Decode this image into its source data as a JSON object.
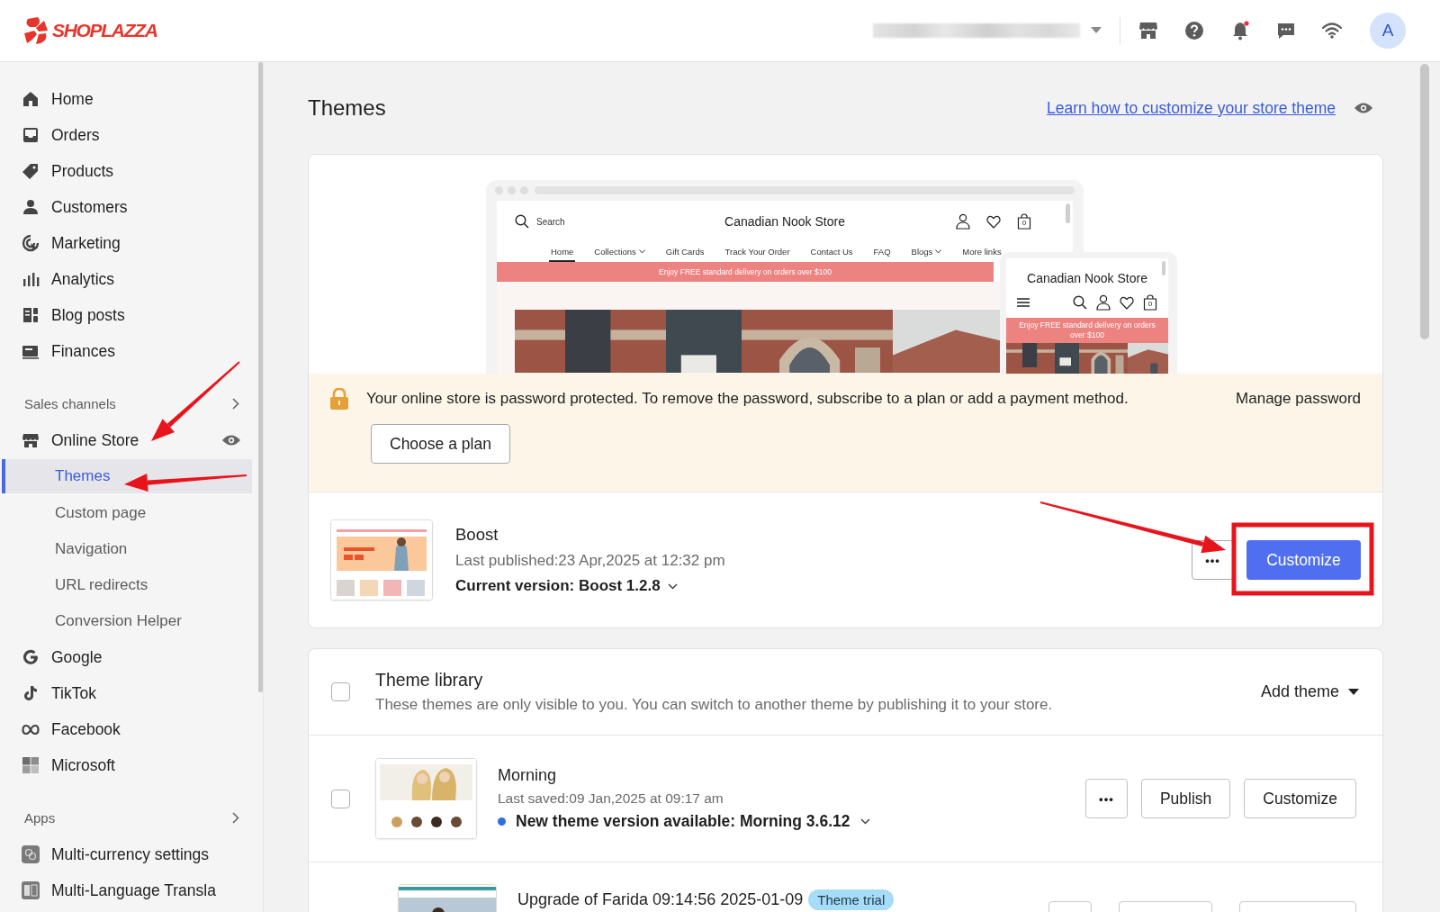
{
  "topbar": {
    "logo": "SHOPLAZZA",
    "avatar": "A"
  },
  "sidebar": {
    "items": [
      {
        "kind": "link",
        "label": "Home",
        "selected": false
      },
      {
        "kind": "link",
        "label": "Orders",
        "selected": false
      },
      {
        "kind": "link",
        "label": "Products",
        "selected": false
      },
      {
        "kind": "link",
        "label": "Customers",
        "selected": false
      },
      {
        "kind": "link",
        "label": "Marketing",
        "selected": false
      },
      {
        "kind": "link",
        "label": "Analytics",
        "selected": false
      },
      {
        "kind": "link",
        "label": "Blog posts",
        "selected": false
      },
      {
        "kind": "link",
        "label": "Finances",
        "selected": false
      },
      {
        "kind": "section",
        "label": "Sales channels"
      },
      {
        "kind": "link",
        "label": "Online Store",
        "selected": false,
        "children": [
          {
            "label": "Themes",
            "selected": true
          },
          {
            "label": "Custom page",
            "selected": false
          },
          {
            "label": "Navigation",
            "selected": false
          },
          {
            "label": "URL redirects",
            "selected": false
          },
          {
            "label": "Conversion Helper",
            "selected": false
          }
        ]
      },
      {
        "kind": "link",
        "label": "Google",
        "selected": false
      },
      {
        "kind": "link",
        "label": "TikTok",
        "selected": false
      },
      {
        "kind": "link",
        "label": "Facebook",
        "selected": false
      },
      {
        "kind": "link",
        "label": "Microsoft",
        "selected": false
      },
      {
        "kind": "section",
        "label": "Apps"
      },
      {
        "kind": "link",
        "label": "Multi-currency settings",
        "selected": false
      },
      {
        "kind": "link",
        "label": "Multi-Language Transla",
        "selected": false
      }
    ]
  },
  "page": {
    "title": "Themes",
    "help_link": "Learn how to customize your store theme"
  },
  "current_theme": {
    "preview": {
      "search": "Search",
      "store_name": "Canadian Nook Store",
      "cart_count": "0",
      "nav": [
        {
          "label": "Home",
          "selected": true,
          "dropdown": false
        },
        {
          "label": "Collections",
          "selected": false,
          "dropdown": true
        },
        {
          "label": "Gift Cards",
          "selected": false,
          "dropdown": false
        },
        {
          "label": "Track Your Order",
          "selected": false,
          "dropdown": false
        },
        {
          "label": "Contact Us",
          "selected": false,
          "dropdown": false
        },
        {
          "label": "FAQ",
          "selected": false,
          "dropdown": false
        },
        {
          "label": "Blogs",
          "selected": false,
          "dropdown": true
        },
        {
          "label": "More links",
          "selected": false,
          "dropdown": false
        }
      ],
      "announcement": "Enjoy FREE standard delivery on orders over $100",
      "mobile": {
        "store_name": "Canadian Nook Store",
        "cart_count": "0",
        "announcement": "Enjoy FREE standard delivery on orders over $100"
      }
    },
    "banner": {
      "message": "Your online store is password protected. To remove the password, subscribe to a plan or add a payment method.",
      "manage": "Manage password",
      "button": "Choose a plan"
    },
    "name": "Boost",
    "published": "Last published:23 Apr,2025 at 12:32 pm",
    "version": "Current version: Boost 1.2.8",
    "more": "•••",
    "customize": "Customize"
  },
  "library": {
    "title": "Theme library",
    "description": "These themes are only visible to you. You can switch to another theme by publishing it to your store.",
    "add_theme": "Add theme",
    "checked": false,
    "themes": [
      {
        "name": "Morning",
        "saved": "Last saved:09 Jan,2025 at 09:17 am",
        "update": "New theme version available: Morning 3.6.12",
        "more": "•••",
        "buttons": [
          "Publish",
          "Customize"
        ],
        "checked": false
      },
      {
        "name": "Upgrade of Farida 09:14:56 2025-01-09",
        "badge": "Theme trial"
      }
    ]
  }
}
